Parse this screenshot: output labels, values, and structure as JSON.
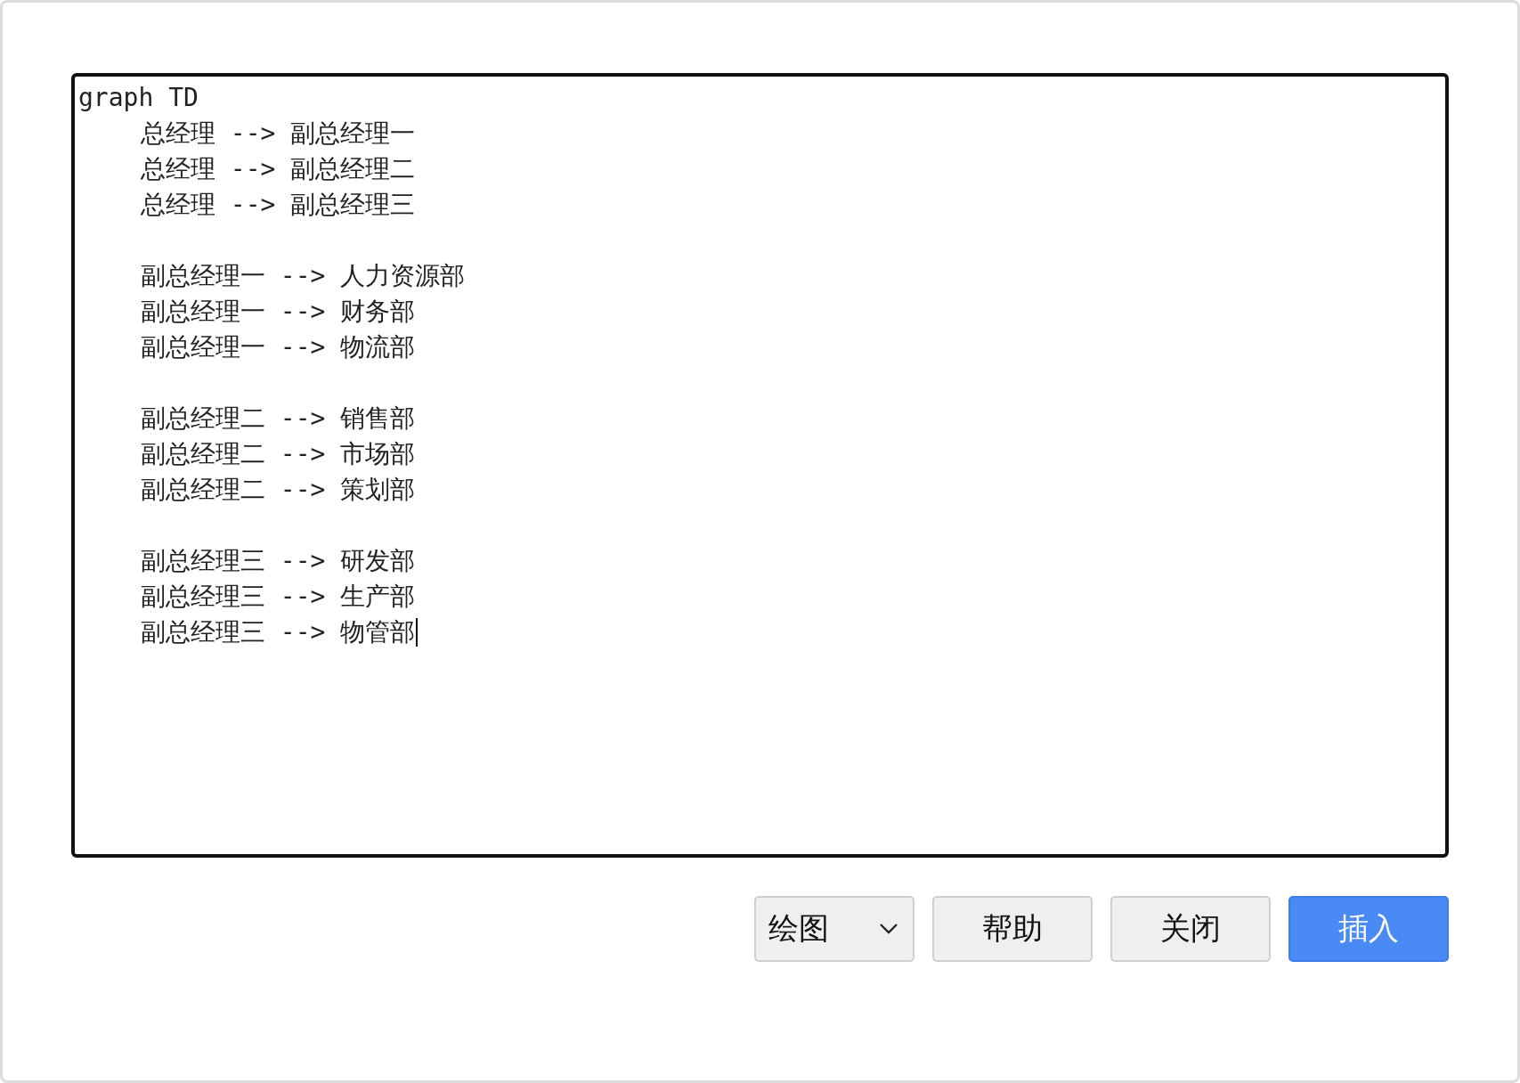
{
  "editor": {
    "header": "graph TD",
    "groups": [
      [
        "总经理 --> 副总经理一",
        "总经理 --> 副总经理二",
        "总经理 --> 副总经理三"
      ],
      [
        "副总经理一 --> 人力资源部",
        "副总经理一 --> 财务部",
        "副总经理一 --> 物流部"
      ],
      [
        "副总经理二 --> 销售部",
        "副总经理二 --> 市场部",
        "副总经理二 --> 策划部"
      ],
      [
        "副总经理三 --> 研发部",
        "副总经理三 --> 生产部",
        "副总经理三 --> 物管部"
      ]
    ]
  },
  "buttons": [
    {
      "label": "绘图",
      "kind": "dropdown"
    },
    {
      "label": "帮助",
      "kind": "plain"
    },
    {
      "label": "关闭",
      "kind": "plain"
    },
    {
      "label": "插入",
      "kind": "primary"
    }
  ]
}
